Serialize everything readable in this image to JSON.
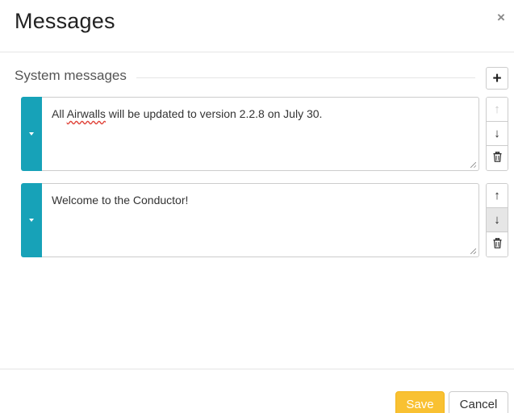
{
  "modal": {
    "title": "Messages",
    "close_glyph": "×"
  },
  "section": {
    "title": "System messages",
    "add_glyph": "+"
  },
  "messages": [
    {
      "text_before": "All ",
      "text_flagged": "Airwalls",
      "text_after": " will be updated to version 2.2.8 on July 30.",
      "move_up_enabled": false,
      "move_down_enabled": true
    },
    {
      "text": "Welcome to the Conductor!",
      "move_up_enabled": true,
      "move_down_enabled": true
    }
  ],
  "controls": {
    "up_glyph": "↑",
    "down_glyph": "↓",
    "delete_icon": "trash-icon",
    "expand_icon": "caret-down-icon"
  },
  "footer": {
    "save_label": "Save",
    "cancel_label": "Cancel"
  },
  "colors": {
    "accent": "#17a2b8",
    "save": "#f9c132"
  }
}
